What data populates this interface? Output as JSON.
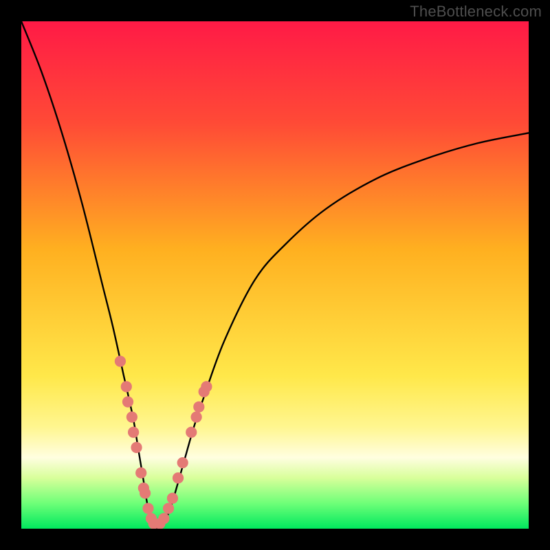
{
  "watermark": "TheBottleneck.com",
  "chart_data": {
    "type": "line",
    "title": "",
    "xlabel": "",
    "ylabel": "",
    "xlim": [
      0,
      100
    ],
    "ylim": [
      0,
      100
    ],
    "background": {
      "kind": "vertical-gradient",
      "stops": [
        {
          "pos": 0.0,
          "color": "#ff1a46"
        },
        {
          "pos": 0.2,
          "color": "#ff4a36"
        },
        {
          "pos": 0.45,
          "color": "#ffb020"
        },
        {
          "pos": 0.7,
          "color": "#ffe84a"
        },
        {
          "pos": 0.8,
          "color": "#fff690"
        },
        {
          "pos": 0.86,
          "color": "#fffee0"
        },
        {
          "pos": 0.9,
          "color": "#d8ff9a"
        },
        {
          "pos": 0.95,
          "color": "#6eff78"
        },
        {
          "pos": 1.0,
          "color": "#00e85e"
        }
      ]
    },
    "series": [
      {
        "name": "bottleneck-curve",
        "color": "#000000",
        "x": [
          0,
          4,
          8,
          12,
          16,
          18,
          20,
          22,
          23,
          24,
          25,
          26,
          27,
          28,
          29,
          30,
          32,
          34,
          36,
          40,
          46,
          52,
          60,
          70,
          80,
          90,
          100
        ],
        "y": [
          100,
          90,
          78,
          64,
          48,
          40,
          31,
          22,
          16,
          10,
          4,
          1,
          0,
          1,
          3,
          6,
          13,
          20,
          26,
          37,
          49,
          56,
          63,
          69,
          73,
          76,
          78
        ]
      }
    ],
    "markers": {
      "name": "sample-points",
      "color": "#e47a75",
      "radius_pct": 1.1,
      "points": [
        {
          "x": 19.5,
          "y": 33
        },
        {
          "x": 20.7,
          "y": 28
        },
        {
          "x": 21.0,
          "y": 25
        },
        {
          "x": 21.8,
          "y": 22
        },
        {
          "x": 22.1,
          "y": 19
        },
        {
          "x": 22.7,
          "y": 16
        },
        {
          "x": 23.6,
          "y": 11
        },
        {
          "x": 24.1,
          "y": 8
        },
        {
          "x": 24.4,
          "y": 7
        },
        {
          "x": 25.0,
          "y": 4
        },
        {
          "x": 25.6,
          "y": 2
        },
        {
          "x": 26.1,
          "y": 1
        },
        {
          "x": 27.3,
          "y": 1
        },
        {
          "x": 28.1,
          "y": 2
        },
        {
          "x": 29.0,
          "y": 4
        },
        {
          "x": 29.8,
          "y": 6
        },
        {
          "x": 30.9,
          "y": 10
        },
        {
          "x": 31.8,
          "y": 13
        },
        {
          "x": 33.5,
          "y": 19
        },
        {
          "x": 34.5,
          "y": 22
        },
        {
          "x": 35.0,
          "y": 24
        },
        {
          "x": 36.0,
          "y": 27
        },
        {
          "x": 36.5,
          "y": 28
        }
      ]
    }
  }
}
